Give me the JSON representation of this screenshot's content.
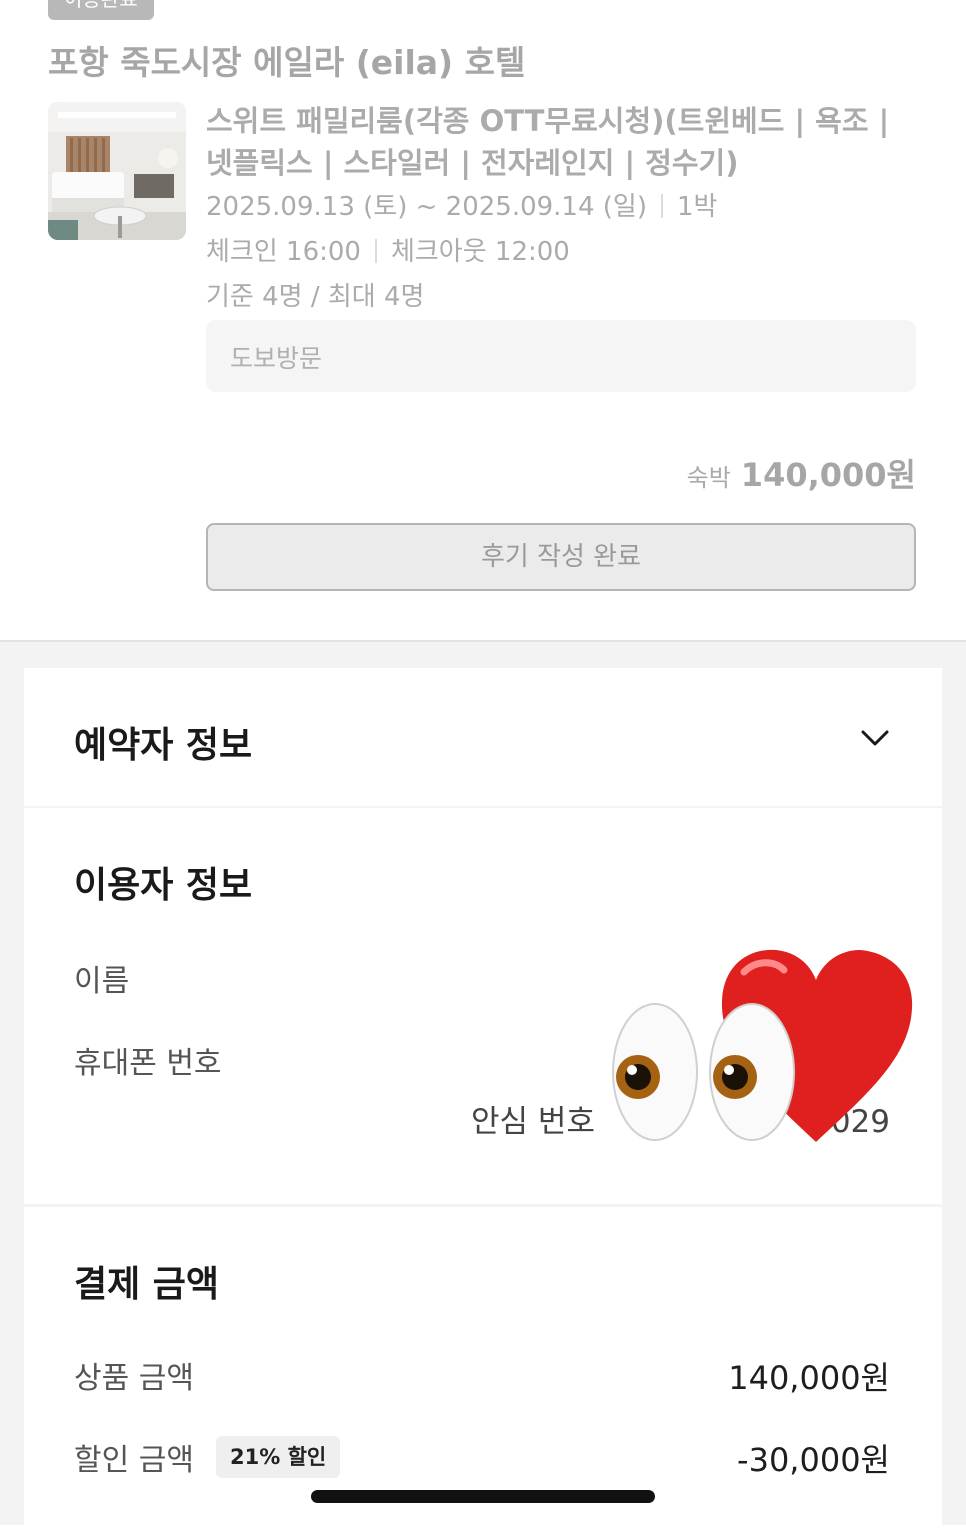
{
  "booking": {
    "status_badge": "이용완료",
    "hotel_name": "포항 죽도시장 에일라 (eila) 호텔",
    "room_name": "스위트 패밀리룸(각종 OTT무료시청)(트윈베드 | 욕조 | 넷플릭스 | 스타일러 | 전자레인지 | 정수기)",
    "dates": "2025.09.13 (토) ~ 2025.09.14 (일)",
    "nights": "1박",
    "checkin": "체크인 16:00",
    "checkout": "체크아웃 12:00",
    "capacity": "기준 4명 / 최대 4명",
    "visit_type": "도보방문",
    "price_label": "숙박",
    "price_value": "140,000원",
    "review_button": "후기 작성 완료"
  },
  "booker_section": {
    "title": "예약자 정보",
    "icon": "chevron-down-icon"
  },
  "user_section": {
    "title": "이용자 정보",
    "name_label": "이름",
    "phone_label": "휴대폰 번호",
    "safe_number_label": "안심 번호",
    "safe_number_suffix": "029"
  },
  "payment_section": {
    "title": "결제 금액",
    "product_label": "상품 금액",
    "product_value": "140,000원",
    "discount_label": "할인 금액",
    "discount_badge": "21% 할인",
    "discount_value": "-30,000원"
  },
  "colors": {
    "muted_text": "#a6a6a6",
    "badge_bg": "#b8b8b8",
    "heart": "#e0201f"
  }
}
